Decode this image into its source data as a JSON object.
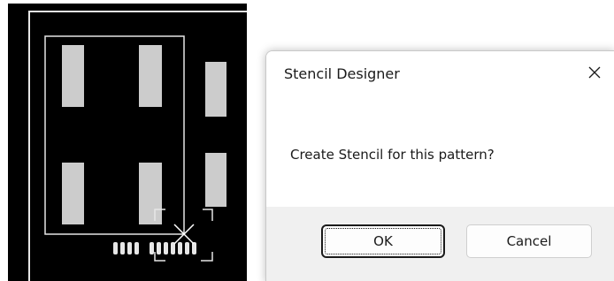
{
  "dialog": {
    "title": "Stencil Designer",
    "message": "Create Stencil for this pattern?",
    "ok_label": "OK",
    "cancel_label": "Cancel",
    "close_icon": "close-icon"
  },
  "colors": {
    "pcb_background": "#000000",
    "pad_fill": "#cccccc",
    "outline": "#e6e6e6",
    "footer_background": "#f0f0f0"
  }
}
